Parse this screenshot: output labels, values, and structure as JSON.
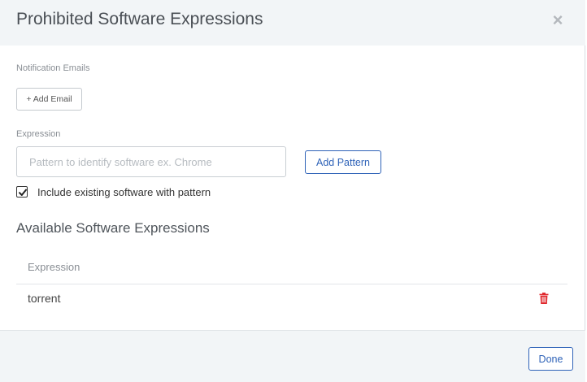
{
  "dialog": {
    "title": "Prohibited Software Expressions",
    "close_symbol": "×"
  },
  "notifications": {
    "label": "Notification Emails",
    "add_email_label": "+ Add Email"
  },
  "expression_form": {
    "label": "Expression",
    "input_value": "",
    "input_placeholder": "Pattern to identify software ex. Chrome",
    "add_pattern_label": "Add Pattern",
    "include_existing_label": "Include existing software with pattern",
    "include_existing_checked": true
  },
  "available": {
    "title": "Available Software Expressions",
    "column_header": "Expression",
    "rows": [
      {
        "expression": "torrent",
        "delete_icon": "trash-icon"
      }
    ]
  },
  "footer": {
    "done_label": "Done"
  },
  "colors": {
    "accent": "#2f63b8",
    "delete": "#e0262b",
    "header_bg": "#f2f5f7"
  }
}
